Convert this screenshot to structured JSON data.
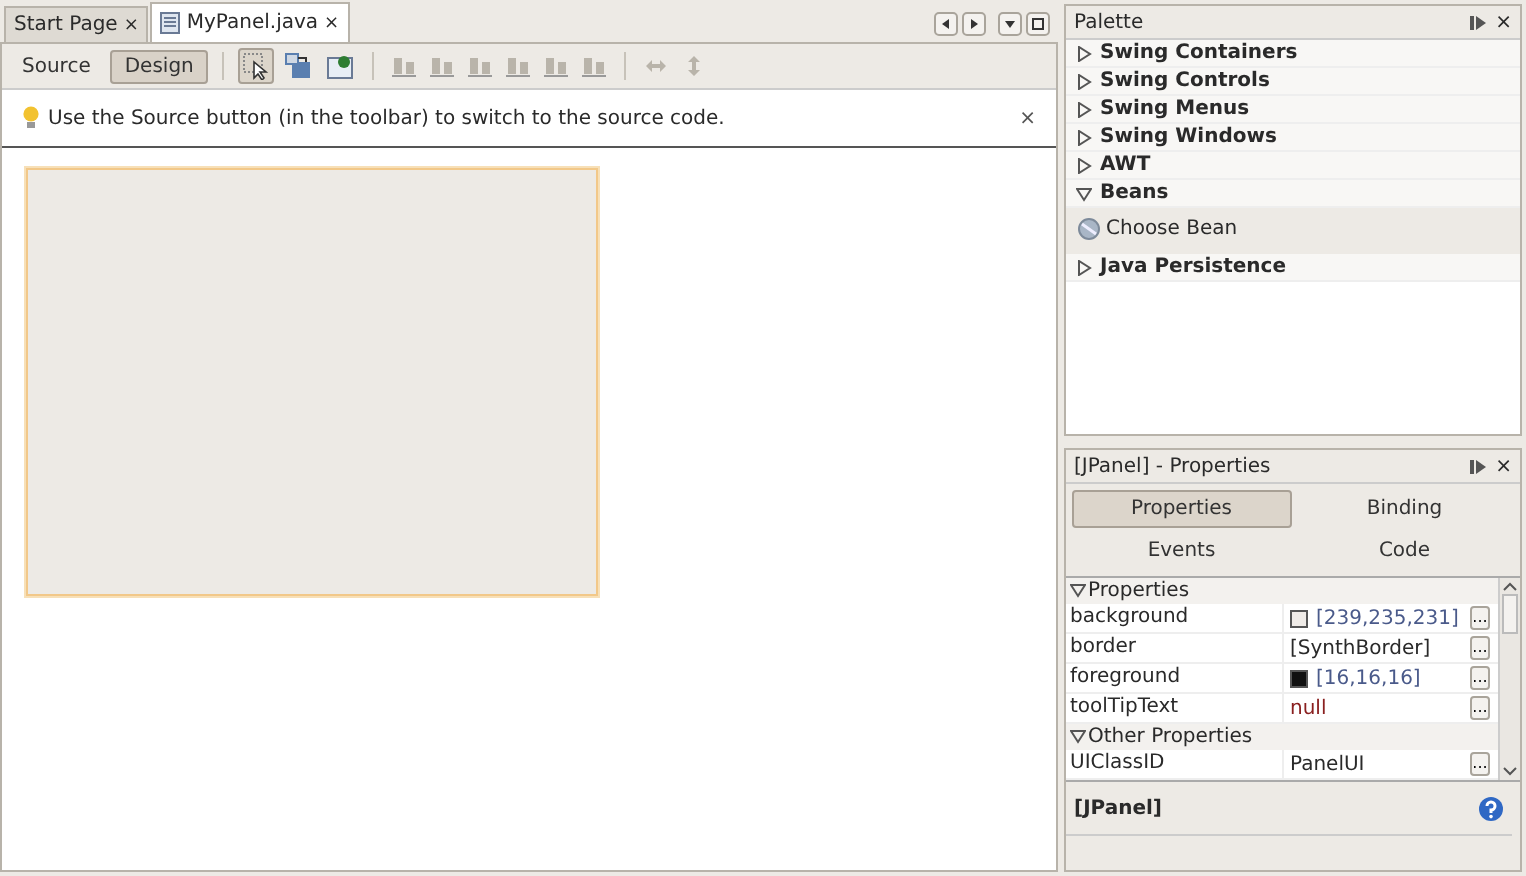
{
  "editor_tabs": [
    {
      "label": "Start Page",
      "selected": false,
      "has_file_icon": false
    },
    {
      "label": "MyPanel.java",
      "selected": true,
      "has_file_icon": true
    }
  ],
  "close_glyph": "×",
  "view_toggle": [
    {
      "label": "Source",
      "selected": false
    },
    {
      "label": "Design",
      "selected": true
    }
  ],
  "tools": [
    {
      "kind": "select",
      "selected": true
    },
    {
      "kind": "connect",
      "selected": false
    },
    {
      "kind": "preview",
      "selected": false
    },
    {
      "kind": "sep"
    },
    {
      "kind": "align",
      "selected": false
    },
    {
      "kind": "align",
      "selected": false
    },
    {
      "kind": "align",
      "selected": false
    },
    {
      "kind": "align",
      "selected": false
    },
    {
      "kind": "align",
      "selected": false
    },
    {
      "kind": "align",
      "selected": false
    },
    {
      "kind": "sep"
    },
    {
      "kind": "hresize",
      "selected": false
    },
    {
      "kind": "vresize",
      "selected": false
    }
  ],
  "hint": {
    "text": "Use the Source button (in the toolbar) to switch to the source code.",
    "close": "×"
  },
  "palette": {
    "title": "Palette",
    "close": "×",
    "categories": [
      {
        "label": "Swing Containers",
        "expanded": false
      },
      {
        "label": "Swing Controls",
        "expanded": false
      },
      {
        "label": "Swing Menus",
        "expanded": false
      },
      {
        "label": "Swing Windows",
        "expanded": false
      },
      {
        "label": "AWT",
        "expanded": false
      },
      {
        "label": "Beans",
        "expanded": true,
        "items": [
          "Choose Bean"
        ]
      },
      {
        "label": "Java Persistence",
        "expanded": false
      }
    ]
  },
  "properties": {
    "title": "[JPanel] - Properties",
    "close": "×",
    "tabs": [
      {
        "label": "Properties",
        "selected": true
      },
      {
        "label": "Binding",
        "selected": false
      },
      {
        "label": "Events",
        "selected": false
      },
      {
        "label": "Code",
        "selected": false
      }
    ],
    "groups": [
      {
        "label": "Properties",
        "expanded": true,
        "rows": [
          {
            "name": "background",
            "kind": "color",
            "value": "[239,235,231]",
            "color": "#efebe7",
            "button": "..."
          },
          {
            "name": "border",
            "kind": "text",
            "value": "[SynthBorder]",
            "button": "..."
          },
          {
            "name": "foreground",
            "kind": "color",
            "value": "[16,16,16]",
            "color": "#101010",
            "button": "..."
          },
          {
            "name": "toolTipText",
            "kind": "null",
            "value": "null",
            "button": "..."
          }
        ]
      },
      {
        "label": "Other Properties",
        "expanded": true,
        "rows": [
          {
            "name": "UIClassID",
            "kind": "text",
            "value": "PanelUI",
            "button": "..."
          }
        ]
      }
    ],
    "description": "[JPanel]"
  }
}
